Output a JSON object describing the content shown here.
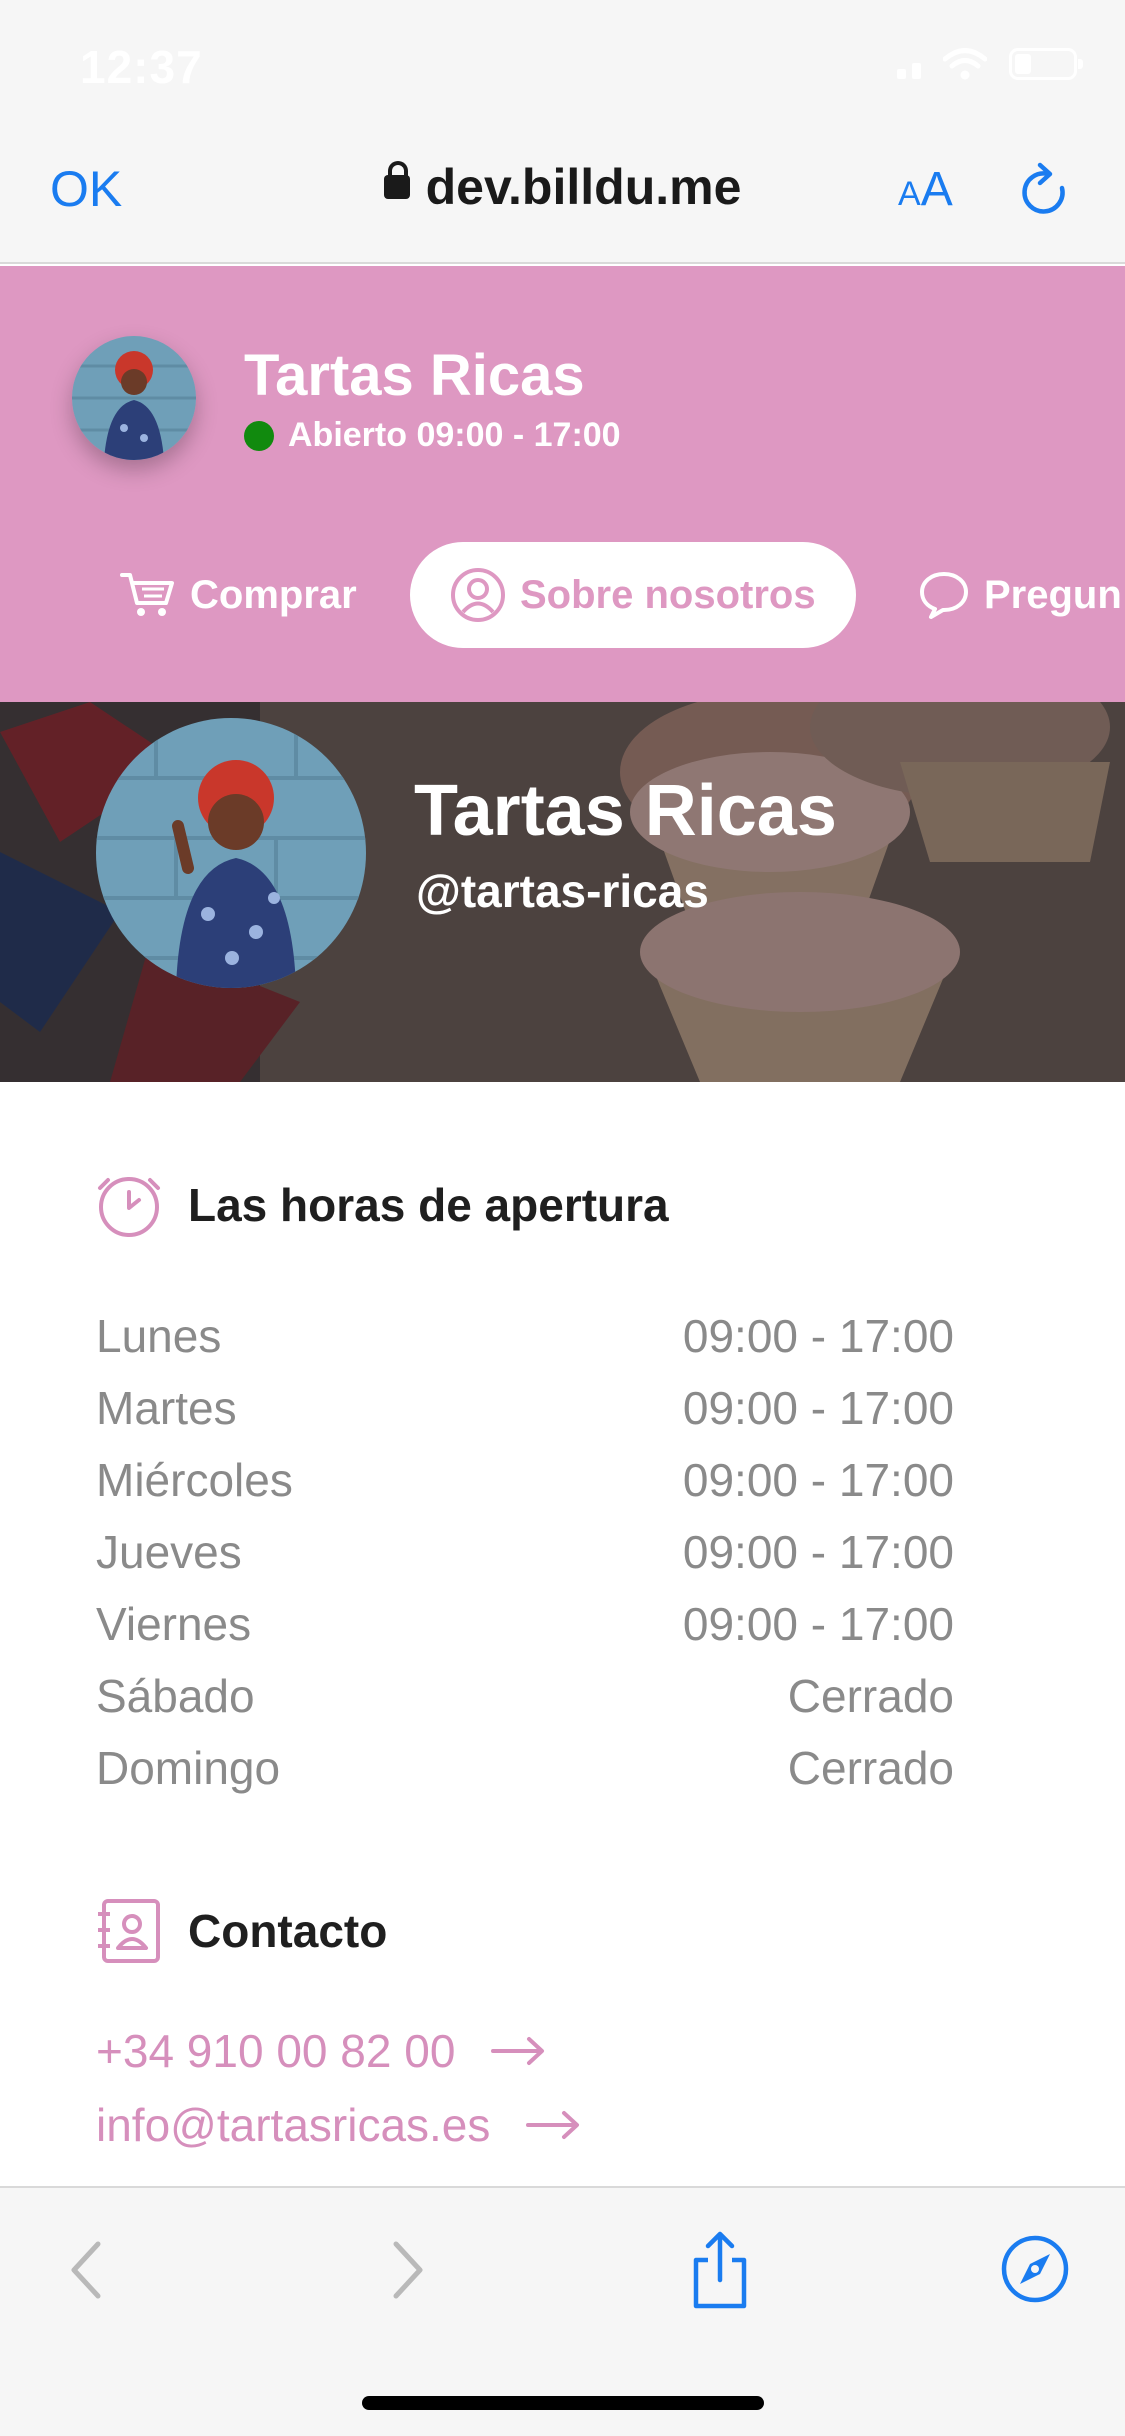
{
  "status_bar": {
    "time": "12:37"
  },
  "browser": {
    "done_label": "OK",
    "url": "dev.billdu.me",
    "text_size_small": "A",
    "text_size_large": "A"
  },
  "shop": {
    "name": "Tartas Ricas",
    "open_status": "Abierto 09:00 - 17:00",
    "handle": "@tartas-ricas",
    "accent_color": "#de98c2",
    "open_color": "#118a0e"
  },
  "tabs": [
    {
      "label": "Comprar",
      "icon": "cart-icon"
    },
    {
      "label": "Sobre nosotros",
      "icon": "user-circle-icon",
      "active": true
    },
    {
      "label": "Pregun",
      "icon": "speech-bubble-icon"
    }
  ],
  "hours_section": {
    "title": "Las horas de apertura",
    "icon": "clock-icon",
    "rows": [
      {
        "day": "Lunes",
        "time": "09:00 - 17:00"
      },
      {
        "day": "Martes",
        "time": "09:00 - 17:00"
      },
      {
        "day": "Miércoles",
        "time": "09:00 - 17:00"
      },
      {
        "day": "Jueves",
        "time": "09:00 - 17:00"
      },
      {
        "day": "Viernes",
        "time": "09:00 - 17:00"
      },
      {
        "day": "Sábado",
        "time": "Cerrado"
      },
      {
        "day": "Domingo",
        "time": "Cerrado"
      }
    ]
  },
  "contact_section": {
    "title": "Contacto",
    "icon": "address-book-icon",
    "phone": "+34 910 00 82 00",
    "email": "info@tartasricas.es"
  },
  "toolbar": {
    "icons": [
      "back-icon",
      "forward-icon",
      "share-icon",
      "compass-icon"
    ]
  }
}
